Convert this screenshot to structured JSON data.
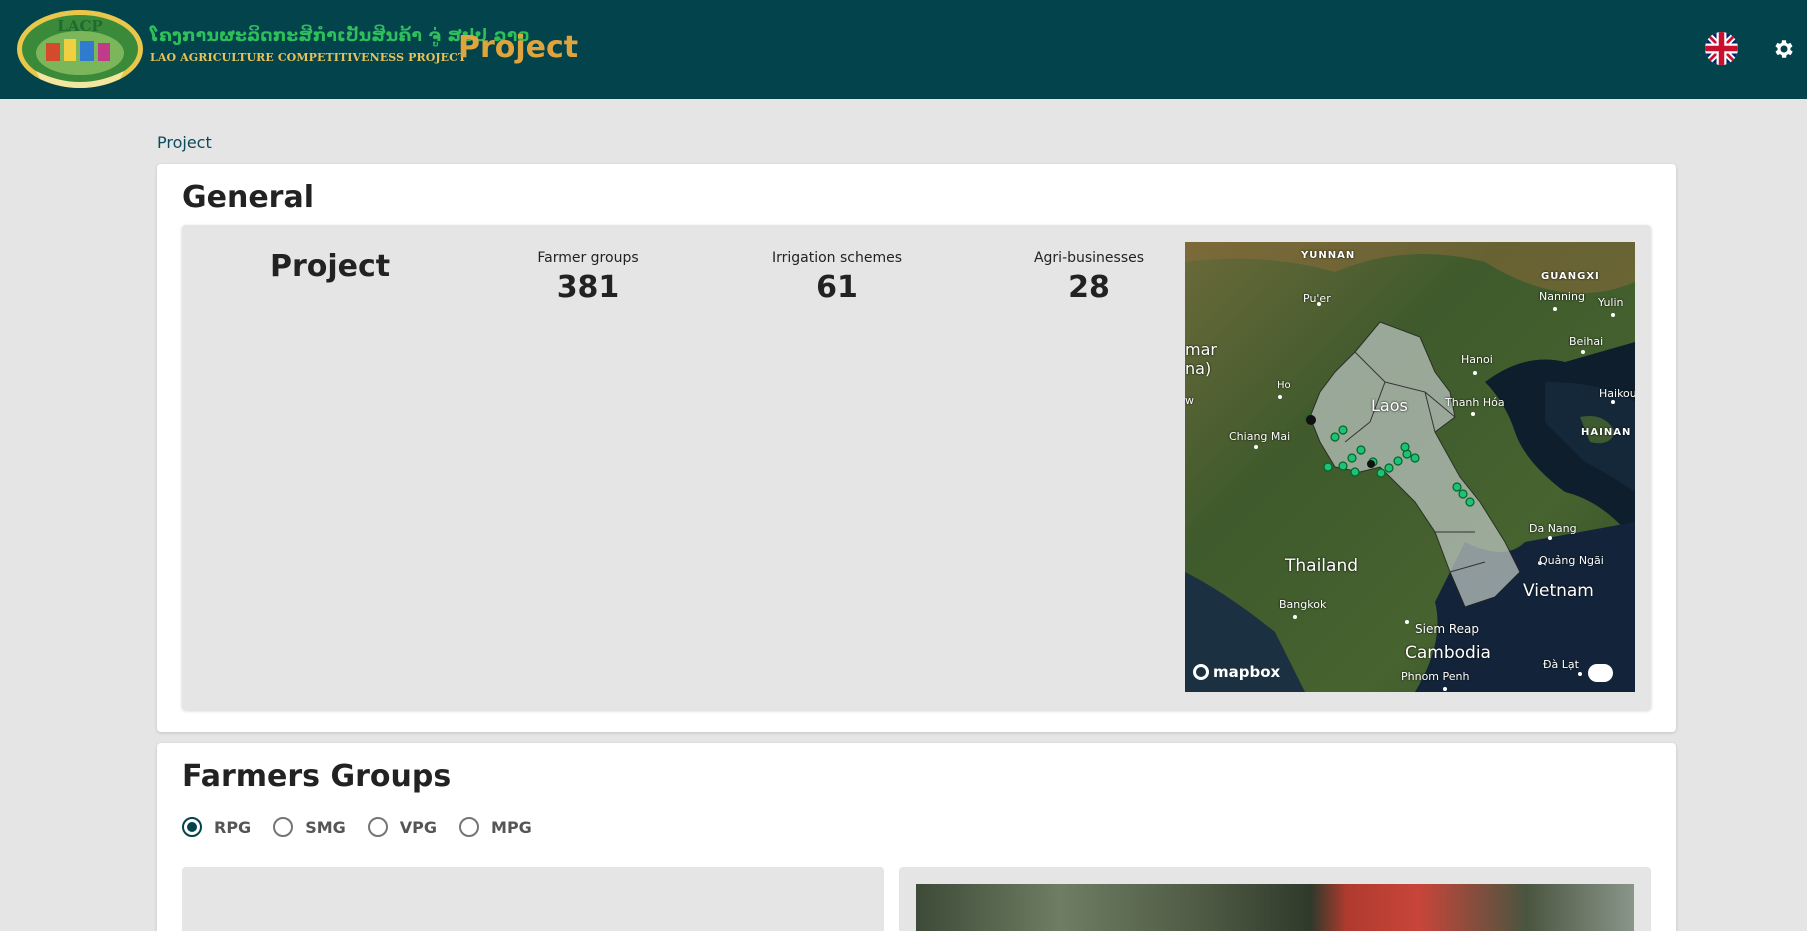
{
  "header": {
    "logo_badge": "LACP",
    "logo_lao": "ໂຄງການຜະລິດກະສິກຳເປັນສິນຄ້າ ຈູ່ ສປປ ລາວ",
    "logo_english": "LAO AGRICULTURE COMPETITIVENESS PROJECT",
    "title": "Project",
    "language_icon": "uk-flag-icon",
    "settings_icon": "gear-icon"
  },
  "breadcrumb": "Project",
  "general": {
    "heading": "General",
    "project_label": "Project",
    "stats": [
      {
        "label": "Farmer groups",
        "value": "381"
      },
      {
        "label": "Irrigation schemes",
        "value": "61"
      },
      {
        "label": "Agri-businesses",
        "value": "28"
      }
    ],
    "map": {
      "labels": {
        "yunnan": "YUNNAN",
        "guangxi": "GUANGXI",
        "puer": "Pu'er",
        "nanning": "Nanning",
        "yulin": "Yulin",
        "beihai": "Beihai",
        "myanmar": "mar",
        "myanmar2": "na)",
        "w": "w",
        "hanoi": "Hanoi",
        "haikou": "Haikou",
        "hainan": "HAINAN",
        "laos": "Laos",
        "thanhhoa": "Thanh Hóa",
        "chiangmai": "Chiang Mai",
        "thailand": "Thailand",
        "danang": "Da Nang",
        "quangngai": "Quảng Ngãi",
        "vietnam": "Vietnam",
        "bangkok": "Bangkok",
        "siemreap": "Siem Reap",
        "cambodia": "Cambodia",
        "phnompenh": "Phnom Penh",
        "dalat": "Đà Lạt",
        "ho": "Ho"
      },
      "attribution": "mapbox"
    }
  },
  "farmers": {
    "heading": "Farmers Groups",
    "options": [
      "RPG",
      "SMG",
      "VPG",
      "MPG"
    ],
    "selected": "RPG"
  }
}
